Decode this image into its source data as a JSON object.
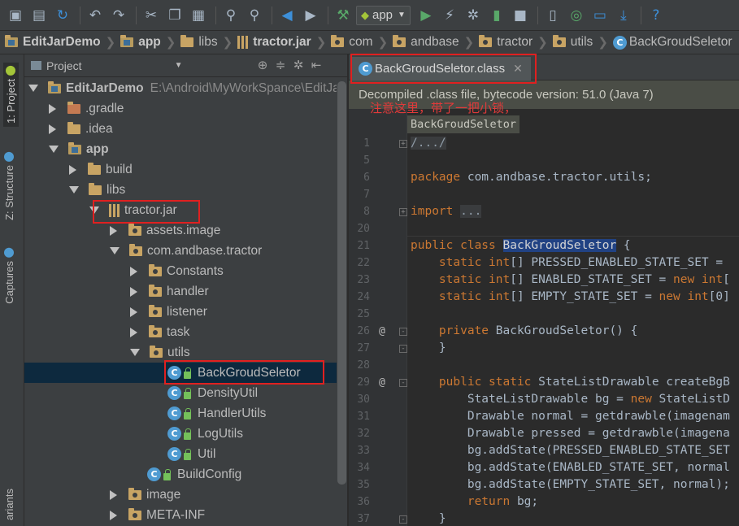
{
  "toolbar": {
    "run_config": "app",
    "icons": [
      "open-icon",
      "save-icon",
      "sync-icon",
      "undo-icon",
      "redo-icon",
      "cut-icon",
      "copy-icon",
      "paste-icon",
      "find-icon",
      "replace-icon",
      "back-icon",
      "forward-icon",
      "build-icon",
      "run-config-combo",
      "run-icon",
      "debug-icon",
      "attach-icon",
      "coverage-icon",
      "stop-icon",
      "avd-icon",
      "gradle-sync-icon",
      "project-structure-icon",
      "sdk-manager-icon",
      "help-icon"
    ]
  },
  "breadcrumb": [
    {
      "label": "EditJarDemo",
      "icon": "module-icon"
    },
    {
      "label": "app",
      "icon": "module-icon"
    },
    {
      "label": "libs",
      "icon": "folder-icon"
    },
    {
      "label": "tractor.jar",
      "icon": "jar-icon"
    },
    {
      "label": "com",
      "icon": "package-icon"
    },
    {
      "label": "andbase",
      "icon": "package-icon"
    },
    {
      "label": "tractor",
      "icon": "package-icon"
    },
    {
      "label": "utils",
      "icon": "package-icon"
    },
    {
      "label": "BackGroudSeletor",
      "icon": "class-icon"
    }
  ],
  "side_tabs": {
    "project": "1: Project",
    "structure": "Z: Structure",
    "captures": "Captures",
    "variants": "ariants"
  },
  "project_panel": {
    "title": "Project",
    "tree": [
      {
        "label": "EditJarDemo",
        "path": "E:\\Android\\MyWorkSpance\\EditJa",
        "indent": 0,
        "arrow": "down",
        "icon": "module"
      },
      {
        "label": ".gradle",
        "indent": 1,
        "arrow": "right",
        "icon": "folder-excl"
      },
      {
        "label": ".idea",
        "indent": 1,
        "arrow": "right",
        "icon": "folder"
      },
      {
        "label": "app",
        "indent": 1,
        "arrow": "down",
        "icon": "module"
      },
      {
        "label": "build",
        "indent": 2,
        "arrow": "right",
        "icon": "folder"
      },
      {
        "label": "libs",
        "indent": 2,
        "arrow": "down",
        "icon": "folder"
      },
      {
        "label": "tractor.jar",
        "indent": 3,
        "arrow": "down",
        "icon": "jar"
      },
      {
        "label": "assets.image",
        "indent": 4,
        "arrow": "right",
        "icon": "package"
      },
      {
        "label": "com.andbase.tractor",
        "indent": 4,
        "arrow": "down",
        "icon": "package"
      },
      {
        "label": "Constants",
        "indent": 5,
        "arrow": "right",
        "icon": "package"
      },
      {
        "label": "handler",
        "indent": 5,
        "arrow": "right",
        "icon": "package"
      },
      {
        "label": "listener",
        "indent": 5,
        "arrow": "right",
        "icon": "package"
      },
      {
        "label": "task",
        "indent": 5,
        "arrow": "right",
        "icon": "package"
      },
      {
        "label": "utils",
        "indent": 5,
        "arrow": "down",
        "icon": "package"
      },
      {
        "label": "BackGroudSeletor",
        "indent": 6,
        "arrow": "none",
        "icon": "class",
        "selected": true
      },
      {
        "label": "DensityUtil",
        "indent": 6,
        "arrow": "none",
        "icon": "class"
      },
      {
        "label": "HandlerUtils",
        "indent": 6,
        "arrow": "none",
        "icon": "class"
      },
      {
        "label": "LogUtils",
        "indent": 6,
        "arrow": "none",
        "icon": "class"
      },
      {
        "label": "Util",
        "indent": 6,
        "arrow": "none",
        "icon": "class"
      },
      {
        "label": "BuildConfig",
        "indent": 5,
        "arrow": "none",
        "icon": "class"
      },
      {
        "label": "image",
        "indent": 4,
        "arrow": "right",
        "icon": "package"
      },
      {
        "label": "META-INF",
        "indent": 4,
        "arrow": "right",
        "icon": "package"
      }
    ]
  },
  "editor": {
    "tab_label": "BackGroudSeletor.class",
    "notice": "Decompiled .class file, bytecode version: 51.0 (Java 7)",
    "annotation": "注意这里，带了一把小锁，",
    "tooltip": "BackGroudSeletor",
    "lines": [
      {
        "n": "1",
        "fold": "+",
        "segs": [
          {
            "t": "/.../",
            "c": "fold-text"
          }
        ]
      },
      {
        "n": "5",
        "segs": []
      },
      {
        "n": "6",
        "segs": [
          {
            "t": "package ",
            "c": "kw"
          },
          {
            "t": "com.andbase.tractor.utils;"
          }
        ]
      },
      {
        "n": "7",
        "segs": []
      },
      {
        "n": "8",
        "fold": "+",
        "segs": [
          {
            "t": "import ",
            "c": "kw"
          },
          {
            "t": "...",
            "c": "fold-text"
          }
        ]
      },
      {
        "n": "20",
        "segs": []
      },
      {
        "n": "21",
        "sep": true,
        "segs": [
          {
            "t": "public class ",
            "c": "kw"
          },
          {
            "t": "BackGroudSeletor",
            "c": "hl"
          },
          {
            "t": " {"
          }
        ]
      },
      {
        "n": "22",
        "segs": [
          {
            "t": "    static int",
            "c": "kw"
          },
          {
            "t": "[] PRESSED_ENABLED_STATE_SET = "
          }
        ]
      },
      {
        "n": "23",
        "segs": [
          {
            "t": "    static int",
            "c": "kw"
          },
          {
            "t": "[] ENABLED_STATE_SET = "
          },
          {
            "t": "new int",
            "c": "kw"
          },
          {
            "t": "["
          }
        ]
      },
      {
        "n": "24",
        "segs": [
          {
            "t": "    static int",
            "c": "kw"
          },
          {
            "t": "[] EMPTY_STATE_SET = "
          },
          {
            "t": "new int",
            "c": "kw"
          },
          {
            "t": "[0]"
          }
        ]
      },
      {
        "n": "25",
        "segs": []
      },
      {
        "n": "26",
        "at": "@",
        "fold": "-",
        "segs": [
          {
            "t": "    private ",
            "c": "kw"
          },
          {
            "t": "BackGroudSeletor() {"
          }
        ]
      },
      {
        "n": "27",
        "fold": "-",
        "segs": [
          {
            "t": "    }"
          }
        ]
      },
      {
        "n": "28",
        "segs": []
      },
      {
        "n": "29",
        "at": "@",
        "fold": "-",
        "segs": [
          {
            "t": "    public static ",
            "c": "kw"
          },
          {
            "t": "StateListDrawable createBgB"
          }
        ]
      },
      {
        "n": "30",
        "segs": [
          {
            "t": "        StateListDrawable bg = "
          },
          {
            "t": "new ",
            "c": "kw"
          },
          {
            "t": "StateListD"
          }
        ]
      },
      {
        "n": "31",
        "segs": [
          {
            "t": "        Drawable normal = getdrawble(imagenam"
          }
        ]
      },
      {
        "n": "32",
        "segs": [
          {
            "t": "        Drawable pressed = getdrawble(imagena"
          }
        ]
      },
      {
        "n": "33",
        "segs": [
          {
            "t": "        bg.addState(PRESSED_ENABLED_STATE_SET"
          }
        ]
      },
      {
        "n": "34",
        "segs": [
          {
            "t": "        bg.addState(ENABLED_STATE_SET, normal"
          }
        ]
      },
      {
        "n": "35",
        "segs": [
          {
            "t": "        bg.addState(EMPTY_STATE_SET, normal);"
          }
        ]
      },
      {
        "n": "36",
        "segs": [
          {
            "t": "        "
          },
          {
            "t": "return ",
            "c": "kw"
          },
          {
            "t": "bg;"
          }
        ]
      },
      {
        "n": "37",
        "fold": "-",
        "segs": [
          {
            "t": "    }"
          }
        ]
      }
    ]
  }
}
